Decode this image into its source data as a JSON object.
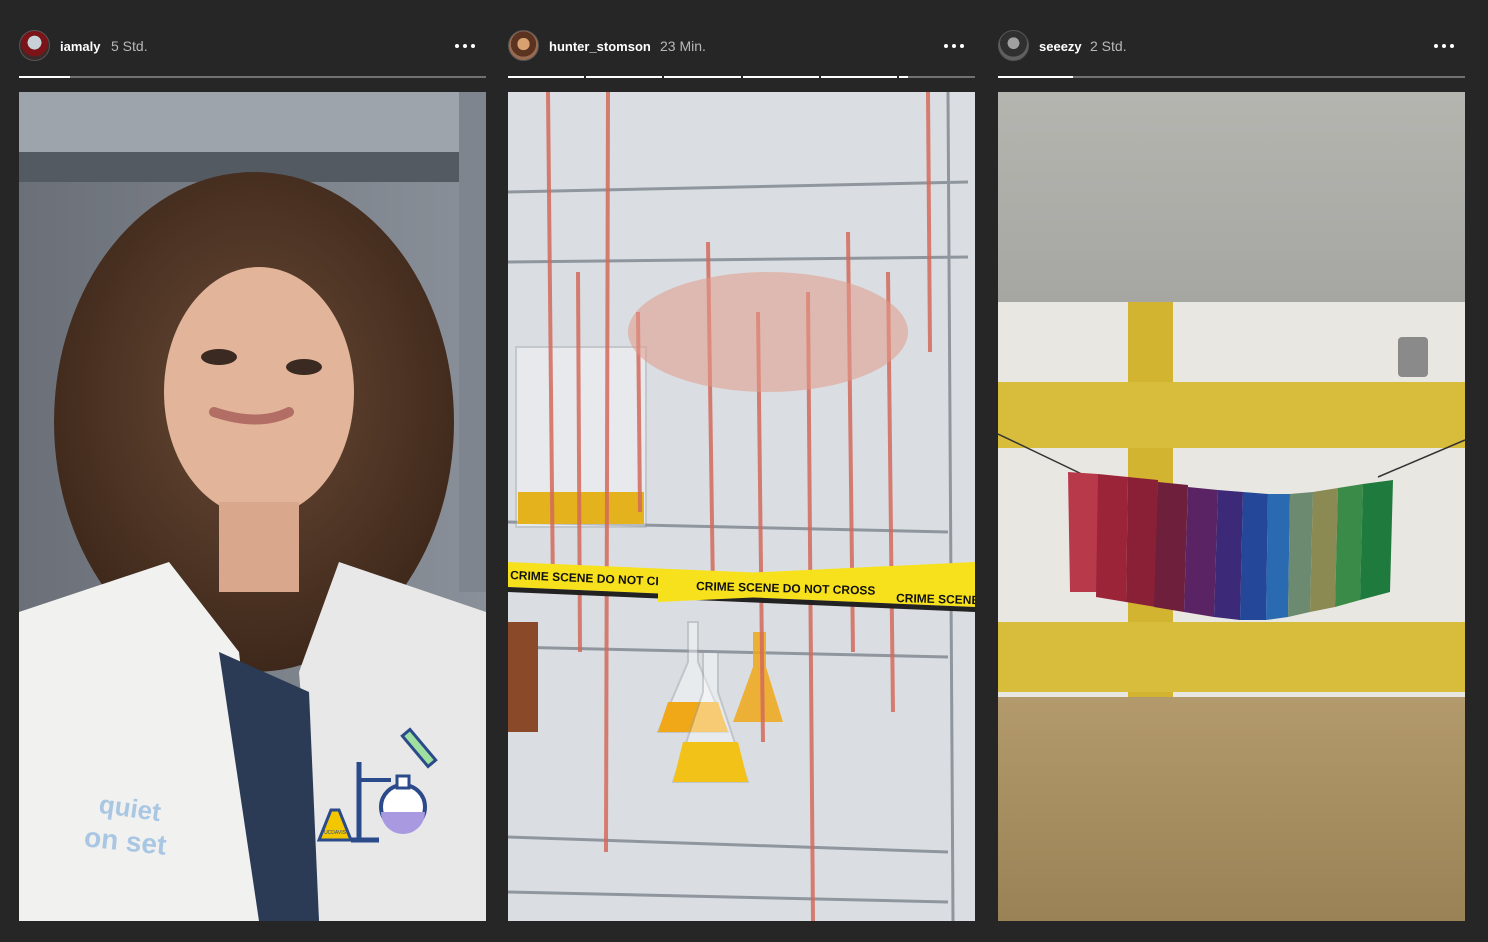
{
  "stories": [
    {
      "username": "iamaly",
      "time": "5 Std.",
      "avatar": "avatar-iamaly",
      "progress": [
        0.11
      ],
      "sticker_text": [
        "quiet",
        "on set"
      ],
      "sticker_label": "UCDAVIS"
    },
    {
      "username": "hunter_stomson",
      "time": "23 Min.",
      "avatar": "avatar-hunter-stomson",
      "progress": [
        1,
        1,
        1,
        1,
        1,
        0.12
      ],
      "tape_texts": [
        "CRIME SCENE DO NOT CROSS",
        "CRIME SCENE DO NOT CROSS",
        "CRIME SCENE"
      ]
    },
    {
      "username": "seeezy",
      "time": "2 Std.",
      "avatar": "avatar-seeezy",
      "progress": [
        0.16
      ]
    }
  ],
  "icons": {
    "more": "more-horizontal-icon"
  },
  "colors": {
    "background": "#262626",
    "text": "#ffffff",
    "muted": "#b8b8b8"
  }
}
